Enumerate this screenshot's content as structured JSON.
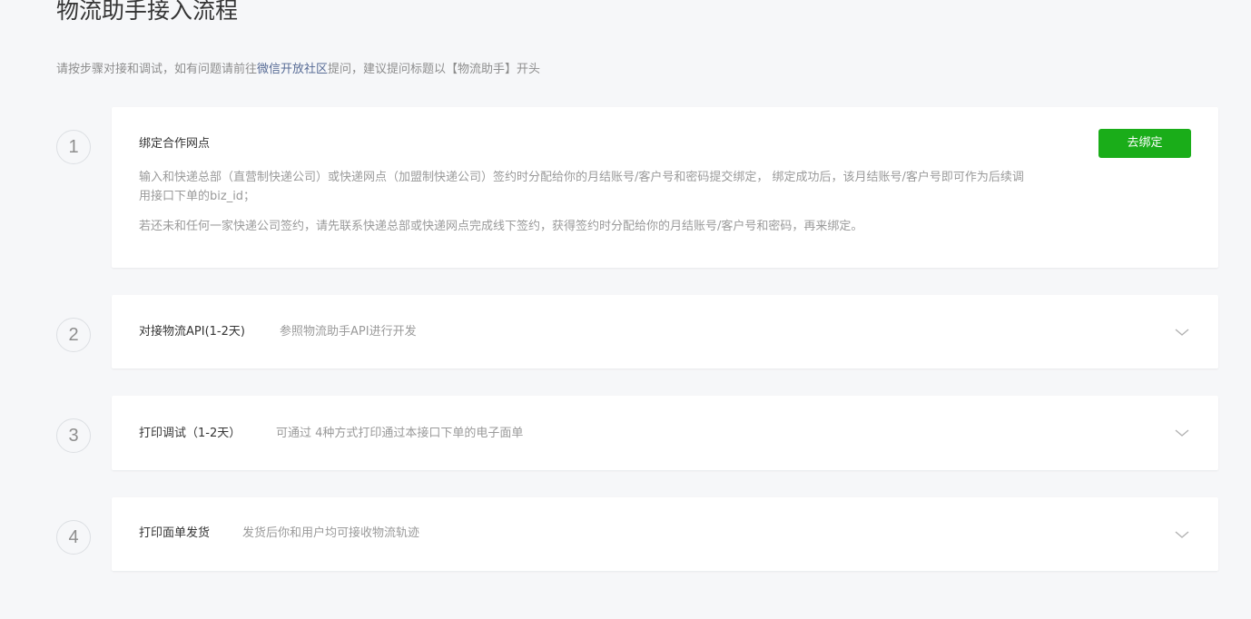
{
  "page": {
    "title": "物流助手接入流程",
    "intro_before": "请按步骤对接和调试，如有问题请前往",
    "intro_link": "微信开放社区",
    "intro_after": "提问，建议提问标题以【物流助手】开头"
  },
  "steps": [
    {
      "number": "1",
      "title": "绑定合作网点",
      "button_label": "去绑定",
      "paragraphs": [
        "输入和快递总部（直营制快递公司）或快递网点（加盟制快递公司）签约时分配给你的月结账号/客户号和密码提交绑定， 绑定成功后，该月结账号/客户号即可作为后续调用接口下单的biz_id；",
        "若还未和任何一家快递公司签约，请先联系快递总部或快递网点完成线下签约，获得签约时分配给你的月结账号/客户号和密码，再来绑定。"
      ]
    },
    {
      "number": "2",
      "title": "对接物流API(1-2天)",
      "description": "参照物流助手API进行开发",
      "icon": "chevron-down-icon"
    },
    {
      "number": "3",
      "title": "打印调试（1-2天）",
      "description": "可通过 4种方式打印通过本接口下单的电子面单",
      "icon": "chevron-down-icon"
    },
    {
      "number": "4",
      "title": "打印面单发货",
      "description": "发货后你和用户均可接收物流轨迹",
      "icon": "chevron-down-icon"
    }
  ],
  "colors": {
    "accent_green": "#1aad19",
    "link_blue": "#576b95",
    "background": "#f6f7f9"
  }
}
